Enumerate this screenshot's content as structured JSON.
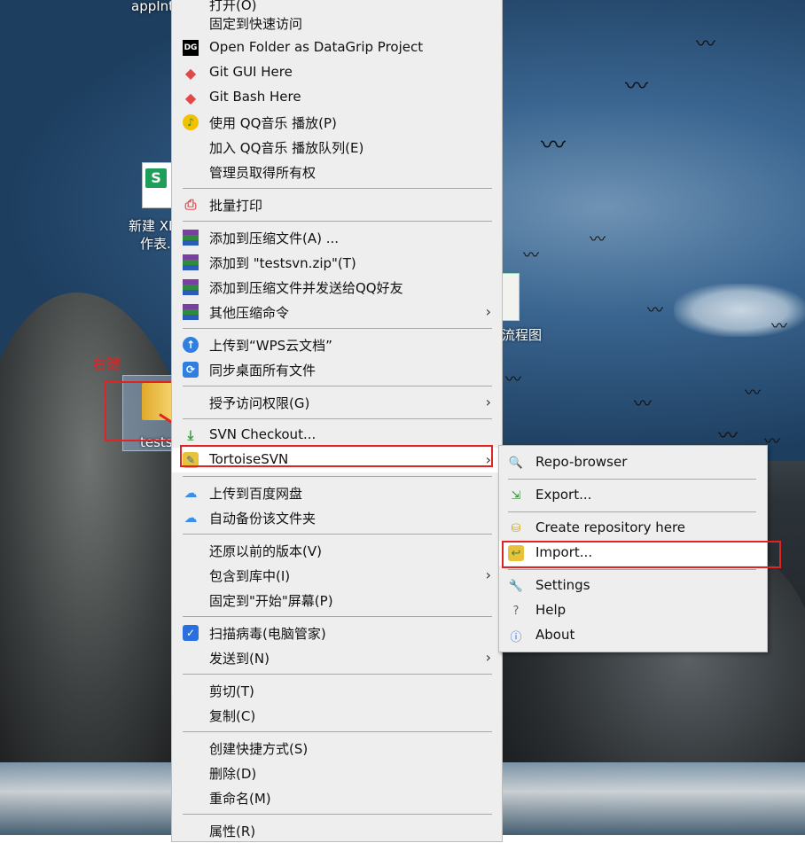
{
  "desktop": {
    "icons": [
      {
        "label_line1": "appInt"
      },
      {
        "label_line1": "新建 XL",
        "label_line2": "作表."
      },
      {
        "label_line1": "流程图"
      },
      {
        "label_line1": "tests"
      }
    ],
    "annotation_text": "右键"
  },
  "context_menu": {
    "items": [
      {
        "label": "打开(O)"
      },
      {
        "label": "固定到快速访问"
      },
      {
        "label": "Open Folder as DataGrip Project",
        "icon": "datagrip-icon"
      },
      {
        "label": "Git GUI Here",
        "icon": "git-icon"
      },
      {
        "label": "Git Bash Here",
        "icon": "git-icon"
      },
      {
        "label": "使用 QQ音乐 播放(P)",
        "icon": "qq-music-icon"
      },
      {
        "label": "加入 QQ音乐 播放队列(E)"
      },
      {
        "label": "管理员取得所有权"
      },
      {
        "label": "批量打印",
        "icon": "printer-icon"
      },
      {
        "label": "添加到压缩文件(A) ...",
        "icon": "winrar-icon"
      },
      {
        "label": "添加到 \"testsvn.zip\"(T)",
        "icon": "winrar-icon"
      },
      {
        "label": "添加到压缩文件并发送给QQ好友",
        "icon": "winrar-icon"
      },
      {
        "label": "其他压缩命令",
        "icon": "winrar-icon"
      },
      {
        "label": "上传到“WPS云文档”",
        "icon": "cloud-upload-icon"
      },
      {
        "label": "同步桌面所有文件",
        "icon": "sync-icon"
      },
      {
        "label": "授予访问权限(G)"
      },
      {
        "label": "SVN Checkout...",
        "icon": "svn-checkout-icon"
      },
      {
        "label": "TortoiseSVN",
        "icon": "tortoisesvn-icon"
      },
      {
        "label": "上传到百度网盘",
        "icon": "baidu-cloud-icon"
      },
      {
        "label": "自动备份该文件夹",
        "icon": "baidu-cloud-icon"
      },
      {
        "label": "还原以前的版本(V)"
      },
      {
        "label": "包含到库中(I)"
      },
      {
        "label": "固定到\"开始\"屏幕(P)"
      },
      {
        "label": "扫描病毒(电脑管家)",
        "icon": "shield-icon"
      },
      {
        "label": "发送到(N)"
      },
      {
        "label": "剪切(T)"
      },
      {
        "label": "复制(C)"
      },
      {
        "label": "创建快捷方式(S)"
      },
      {
        "label": "删除(D)"
      },
      {
        "label": "重命名(M)"
      },
      {
        "label": "属性(R)"
      }
    ]
  },
  "submenu": {
    "items": [
      {
        "label": "Repo-browser",
        "icon": "repo-browser-icon"
      },
      {
        "label": "Export...",
        "icon": "export-icon"
      },
      {
        "label": "Create repository here",
        "icon": "create-repo-icon"
      },
      {
        "label": "Import...",
        "icon": "import-icon"
      },
      {
        "label": "Settings",
        "icon": "settings-icon"
      },
      {
        "label": "Help",
        "icon": "help-icon"
      },
      {
        "label": "About",
        "icon": "about-icon"
      }
    ]
  },
  "colors": {
    "annotation": "#e02424",
    "menu_bg": "#eeeeee",
    "highlight": "#ffffff"
  }
}
